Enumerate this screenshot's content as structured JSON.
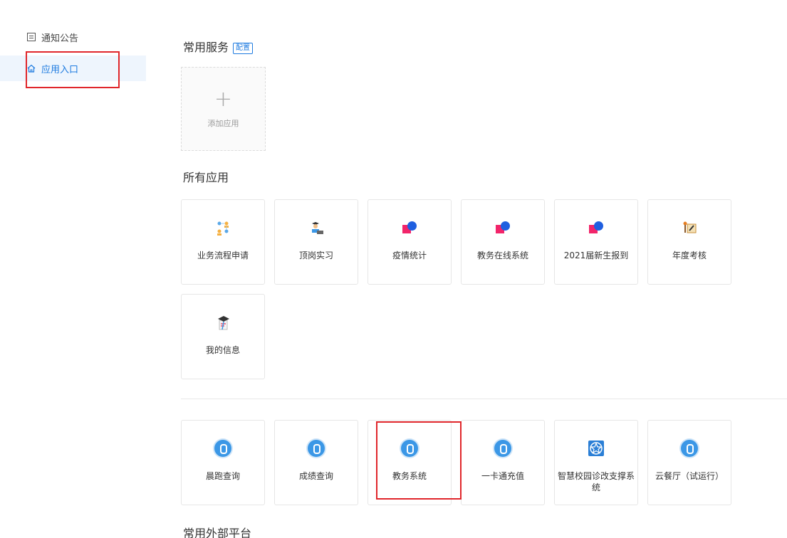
{
  "sidebar": {
    "items": [
      {
        "label": "通知公告",
        "icon": "document-icon"
      },
      {
        "label": "应用入口",
        "icon": "home-icon",
        "active": true
      }
    ]
  },
  "sections": {
    "common_services": {
      "title": "常用服务",
      "config_badge": "配置",
      "add_label": "添加应用"
    },
    "all_apps": {
      "title": "所有应用"
    },
    "external": {
      "title": "常用外部平台"
    }
  },
  "apps": [
    {
      "label": "业务流程申请",
      "icon": "workflow-icon"
    },
    {
      "label": "顶岗实习",
      "icon": "internship-icon"
    },
    {
      "label": "疫情统计",
      "icon": "app-logo-icon"
    },
    {
      "label": "教务在线系统",
      "icon": "app-logo-icon"
    },
    {
      "label": "2021届新生报到",
      "icon": "app-logo-icon"
    },
    {
      "label": "年度考核",
      "icon": "assessment-icon"
    },
    {
      "label": "我的信息",
      "icon": "graduate-icon"
    }
  ],
  "links": [
    {
      "label": "晨跑查询",
      "icon": "link-circle-icon"
    },
    {
      "label": "成绩查询",
      "icon": "link-circle-icon"
    },
    {
      "label": "教务系统",
      "icon": "link-circle-icon"
    },
    {
      "label": "一卡通充值",
      "icon": "link-circle-icon"
    },
    {
      "label": "智慧校园诊改支撑系统",
      "icon": "star-box-icon"
    },
    {
      "label": "云餐厅（试运行）",
      "icon": "link-circle-icon"
    }
  ],
  "colors": {
    "accent": "#1e7be0",
    "highlight": "#e0262b",
    "link_icon": "#3b97e6"
  }
}
